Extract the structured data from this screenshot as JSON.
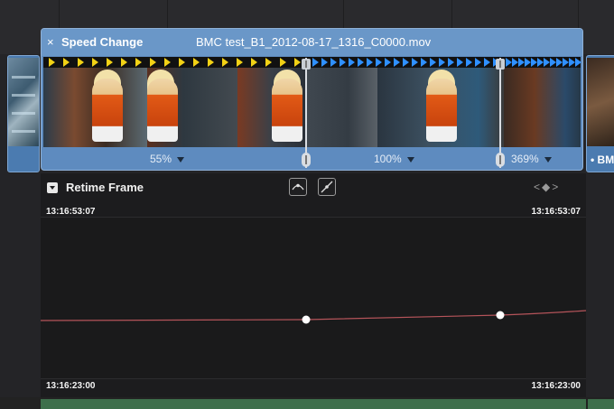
{
  "clip": {
    "close_icon": "×",
    "title": "Speed Change",
    "file_name": "BMC test_B1_2012-08-17_1316_C0000.mov",
    "speeds": [
      {
        "label": "55%"
      },
      {
        "label": "100%"
      },
      {
        "label": "369%"
      }
    ]
  },
  "right_clip": {
    "label": "• BM"
  },
  "retime": {
    "title": "Retime Frame",
    "nav_label": "<◆>",
    "timecode_top_left": "13:16:53:07",
    "timecode_top_right": "13:16:53:07",
    "timecode_bottom_left": "13:16:23:00",
    "timecode_bottom_right": "13:16:23:00"
  },
  "colors": {
    "clip_blue": "#5e8bbf",
    "curve": "#b5545a",
    "arrow_slow": "#f2d215",
    "arrow_fast": "#2f90ff"
  }
}
